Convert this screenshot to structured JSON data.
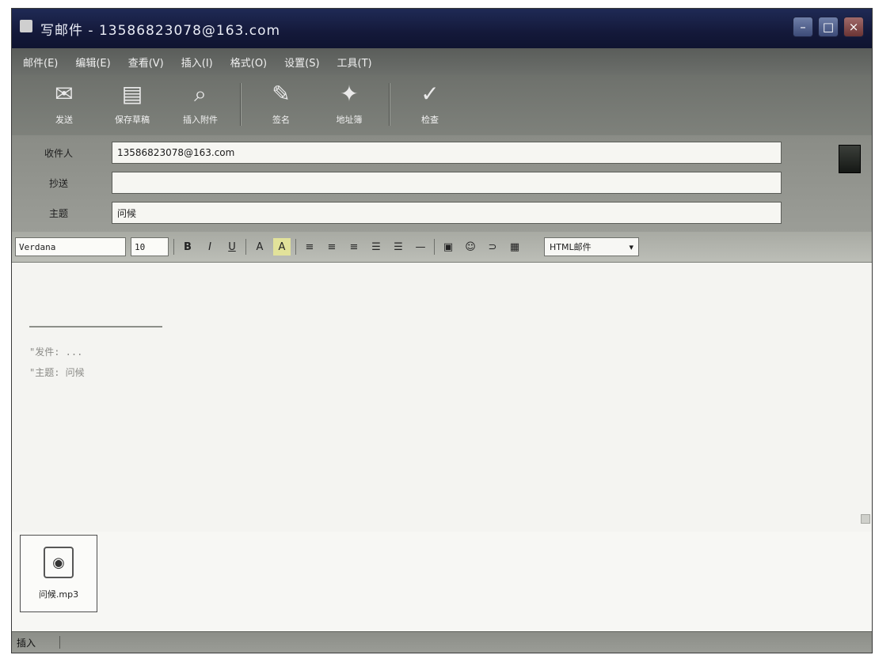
{
  "window": {
    "title": "写邮件 - 13586823078@163.com",
    "minimize_glyph": "–",
    "maximize_glyph": "□",
    "close_glyph": "×"
  },
  "menu": {
    "items": [
      {
        "label": "邮件(E)",
        "icon": ""
      },
      {
        "label": "编辑(E)",
        "icon": ""
      },
      {
        "label": "查看(V)",
        "icon": ""
      },
      {
        "label": "插入(I)",
        "icon": ""
      },
      {
        "label": "格式(O)",
        "icon": ""
      },
      {
        "label": "设置(S)",
        "icon": ""
      },
      {
        "label": "工具(T)",
        "icon": ""
      }
    ]
  },
  "toolbar": {
    "buttons": [
      {
        "label": "发送",
        "icon": "send-icon",
        "glyph": "✉"
      },
      {
        "label": "保存草稿",
        "icon": "save-draft-icon",
        "glyph": "▤"
      },
      {
        "label": "插入附件",
        "icon": "attach-icon",
        "glyph": "⌕"
      },
      {
        "label": "签名",
        "icon": "signature-icon",
        "glyph": "✎"
      },
      {
        "label": "地址簿",
        "icon": "address-book-icon",
        "glyph": "✦"
      },
      {
        "label": "检查",
        "icon": "check-icon",
        "glyph": "✓"
      }
    ]
  },
  "header": {
    "to_label": "收件人",
    "to_value": "13586823078@163.com",
    "cc_label": "抄送",
    "cc_value": "",
    "subject_label": "主题",
    "subject_value": "问候"
  },
  "format": {
    "font": "Verdana",
    "size": "10",
    "bold": "B",
    "italic": "I",
    "underline": "U",
    "font_color": "A",
    "highlight": "A",
    "align_left": "≡",
    "align_center": "≡",
    "align_right": "≡",
    "ordered_list": "☰",
    "bullet_list": "☰",
    "hr": "—",
    "html_mode": "HTML邮件"
  },
  "body": {
    "quote_line_1": "\"发件: ...",
    "quote_line_2": "\"主题: 问候"
  },
  "attachments": [
    {
      "name": "问候.mp3",
      "icon": "audio-file-icon"
    }
  ],
  "status": {
    "mode": "插入"
  }
}
